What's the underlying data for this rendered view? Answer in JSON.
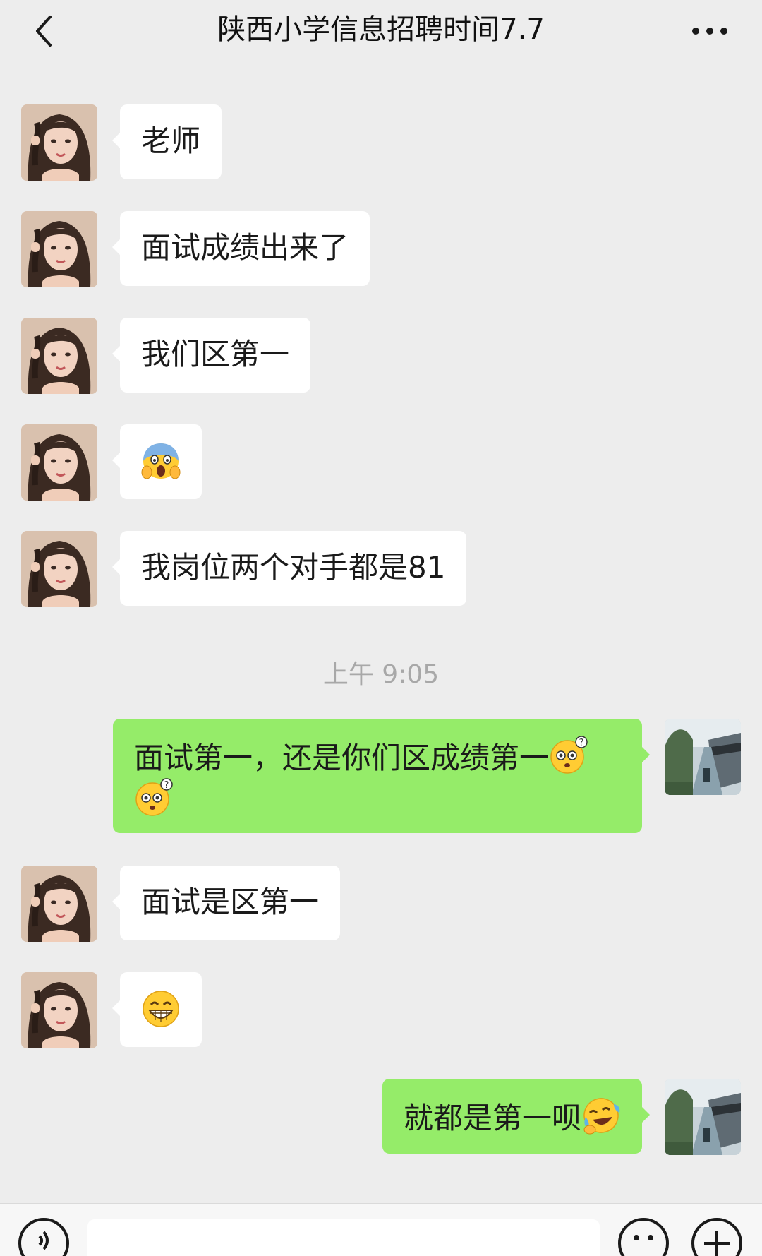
{
  "header": {
    "back_icon": "chevron-left-icon",
    "title": "陕西小学信息招聘时间7.7",
    "more_icon": "more-horizontal-icon"
  },
  "messages": [
    {
      "side": "left",
      "text": "老师"
    },
    {
      "side": "left",
      "text": "面试成绩出来了"
    },
    {
      "side": "left",
      "text": "我们区第一"
    },
    {
      "side": "left",
      "emoji": "scream-emoji"
    },
    {
      "side": "left",
      "text": "我岗位两个对手都是81"
    },
    {
      "timestamp": "上午 9:05"
    },
    {
      "side": "right",
      "text": "面试第一，还是你们区成绩第一",
      "emojis": [
        "confused-emoji",
        "confused-emoji"
      ]
    },
    {
      "side": "left",
      "text": "面试是区第一"
    },
    {
      "side": "left",
      "emoji": "grin-emoji"
    },
    {
      "side": "right",
      "text": "就都是第一呗",
      "emojis": [
        "laugh-cry-emoji"
      ]
    }
  ],
  "input_bar": {
    "voice_icon": "voice-icon",
    "input_value": "",
    "emoji_icon": "emoji-icon",
    "plus_icon": "plus-icon"
  },
  "colors": {
    "background": "#ededed",
    "received_bubble": "#ffffff",
    "sent_bubble": "#95ec69",
    "timestamp_text": "#a8a8a8"
  }
}
